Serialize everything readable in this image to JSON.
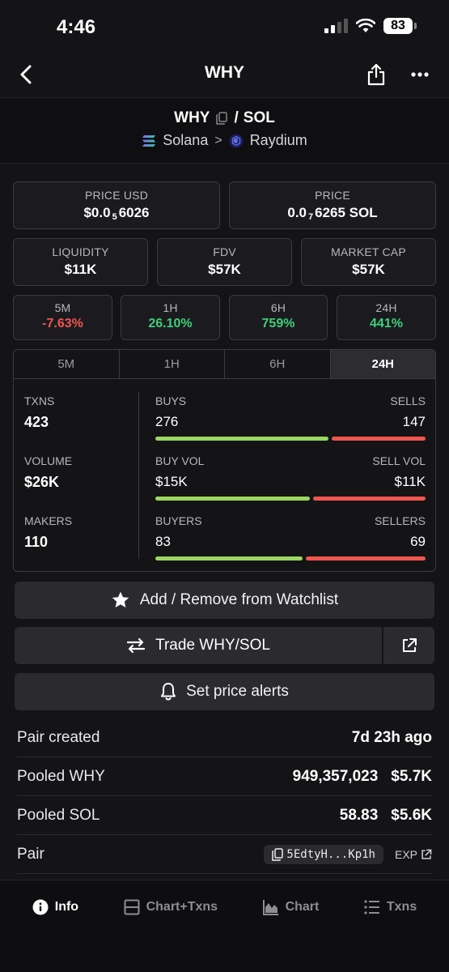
{
  "status_bar": {
    "time": "4:46",
    "battery": "83"
  },
  "header": {
    "title": "WHY"
  },
  "pair": {
    "base": "WHY",
    "separator": "/",
    "quote": "SOL",
    "chain": "Solana",
    "dex": "Raydium"
  },
  "price_usd": {
    "label": "PRICE USD",
    "prefix": "$0.0",
    "zeros": "5",
    "digits": "6026"
  },
  "price_native": {
    "label": "PRICE",
    "prefix": "0.0",
    "zeros": "7",
    "digits": "6265 SOL"
  },
  "liquidity": {
    "label": "LIQUIDITY",
    "value": "$11K"
  },
  "fdv": {
    "label": "FDV",
    "value": "$57K"
  },
  "market_cap": {
    "label": "MARKET CAP",
    "value": "$57K"
  },
  "changes": [
    {
      "label": "5M",
      "value": "-7.63%",
      "direction": "negative"
    },
    {
      "label": "1H",
      "value": "26.10%",
      "direction": "positive"
    },
    {
      "label": "6H",
      "value": "759%",
      "direction": "positive"
    },
    {
      "label": "24H",
      "value": "441%",
      "direction": "positive"
    }
  ],
  "stats_tabs": [
    "5M",
    "1H",
    "6H",
    "24H"
  ],
  "stats_active_tab": "24H",
  "stats": {
    "txns": {
      "label": "TXNS",
      "value": "423"
    },
    "volume": {
      "label": "VOLUME",
      "value": "$26K"
    },
    "makers": {
      "label": "MAKERS",
      "value": "110"
    },
    "buys": {
      "label": "BUYS",
      "value": "276",
      "share": 0.65
    },
    "sells": {
      "label": "SELLS",
      "value": "147"
    },
    "buy_vol": {
      "label": "BUY VOL",
      "value": "$15K",
      "share": 0.58
    },
    "sell_vol": {
      "label": "SELL VOL",
      "value": "$11K"
    },
    "buyers": {
      "label": "BUYERS",
      "value": "83",
      "share": 0.55
    },
    "sellers": {
      "label": "SELLERS",
      "value": "69"
    }
  },
  "actions": {
    "watchlist": "Add / Remove from Watchlist",
    "trade": "Trade WHY/SOL",
    "alerts": "Set price alerts"
  },
  "info": {
    "pair_created": {
      "label": "Pair created",
      "value": "7d 23h ago"
    },
    "pooled_base": {
      "label": "Pooled WHY",
      "amount": "949,357,023",
      "usd": "$5.7K"
    },
    "pooled_quote": {
      "label": "Pooled SOL",
      "amount": "58.83",
      "usd": "$5.6K"
    },
    "pair_address": {
      "label": "Pair",
      "address": "5EdtyH...Kp1h",
      "explorer": "EXP"
    }
  },
  "bottom_nav": [
    {
      "label": "Info",
      "icon": "info-icon",
      "active": true
    },
    {
      "label": "Chart+Txns",
      "icon": "split-layout-icon",
      "active": false
    },
    {
      "label": "Chart",
      "icon": "area-chart-icon",
      "active": false
    },
    {
      "label": "Txns",
      "icon": "list-icon",
      "active": false
    }
  ],
  "colors": {
    "positive": "#3fcf7a",
    "negative": "#f0554f",
    "buy_bar": "#9bd85f",
    "sell_bar": "#f0554f"
  }
}
